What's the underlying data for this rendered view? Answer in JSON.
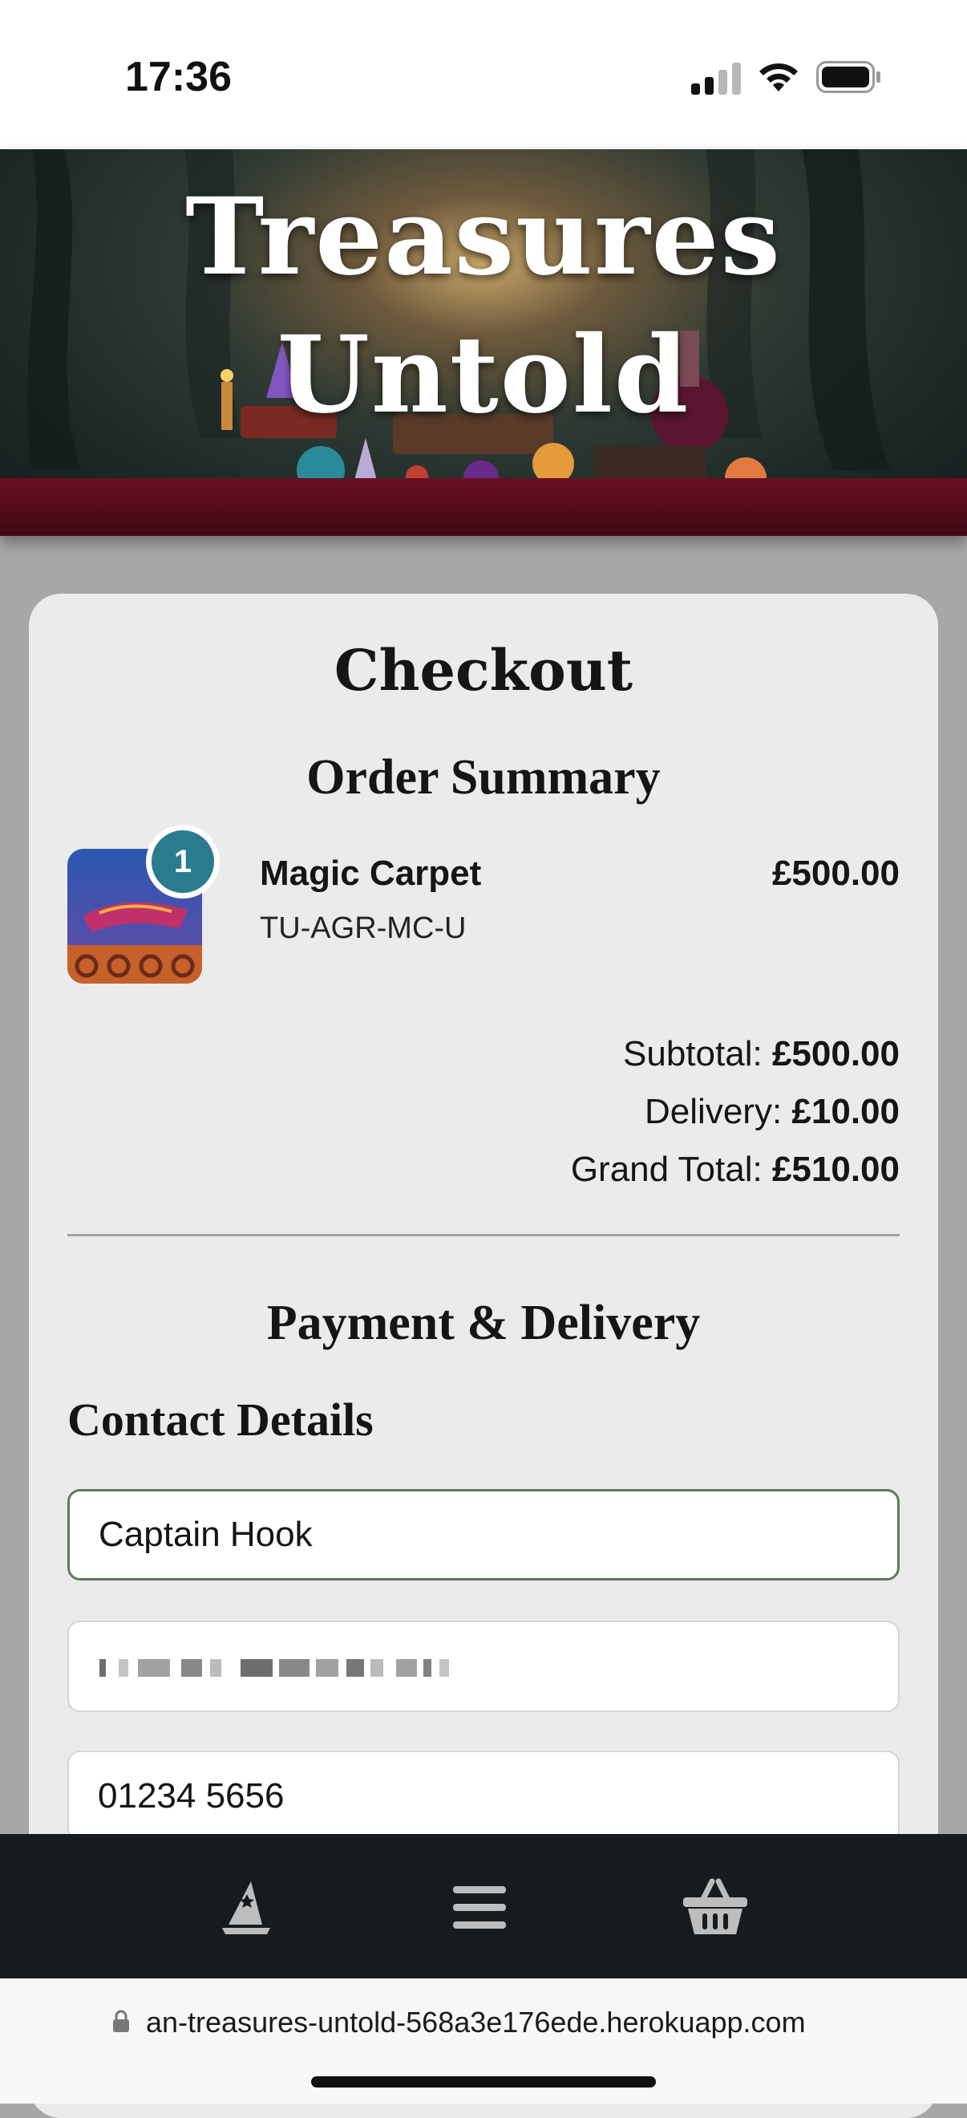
{
  "status_bar": {
    "time": "17:36"
  },
  "hero": {
    "title_line1": "Treasures",
    "title_line2": "Untold"
  },
  "checkout": {
    "title": "Checkout",
    "order_summary_heading": "Order Summary",
    "item": {
      "quantity": "1",
      "name": "Magic Carpet",
      "sku": "TU-AGR-MC-U",
      "price": "£500.00"
    },
    "totals": {
      "subtotal_label": "Subtotal:",
      "subtotal_value": "£500.00",
      "delivery_label": "Delivery:",
      "delivery_value": "£10.00",
      "grand_total_label": "Grand Total:",
      "grand_total_value": "£510.00"
    },
    "payment_heading": "Payment & Delivery",
    "contact_heading": "Contact Details",
    "fields": {
      "full_name": "Captain Hook",
      "phone": "01234 5656"
    }
  },
  "bottom_nav": {
    "items": [
      "wizard-hat-icon",
      "menu-icon",
      "basket-icon"
    ]
  },
  "address_bar": {
    "url": "an-treasures-untold-568a3e176ede.herokuapp.com"
  },
  "colors": {
    "badge": "#2a7b8d",
    "nav_background": "#161b1f",
    "focused_border": "#5e7a5a",
    "card_background": "#ebebeb"
  }
}
